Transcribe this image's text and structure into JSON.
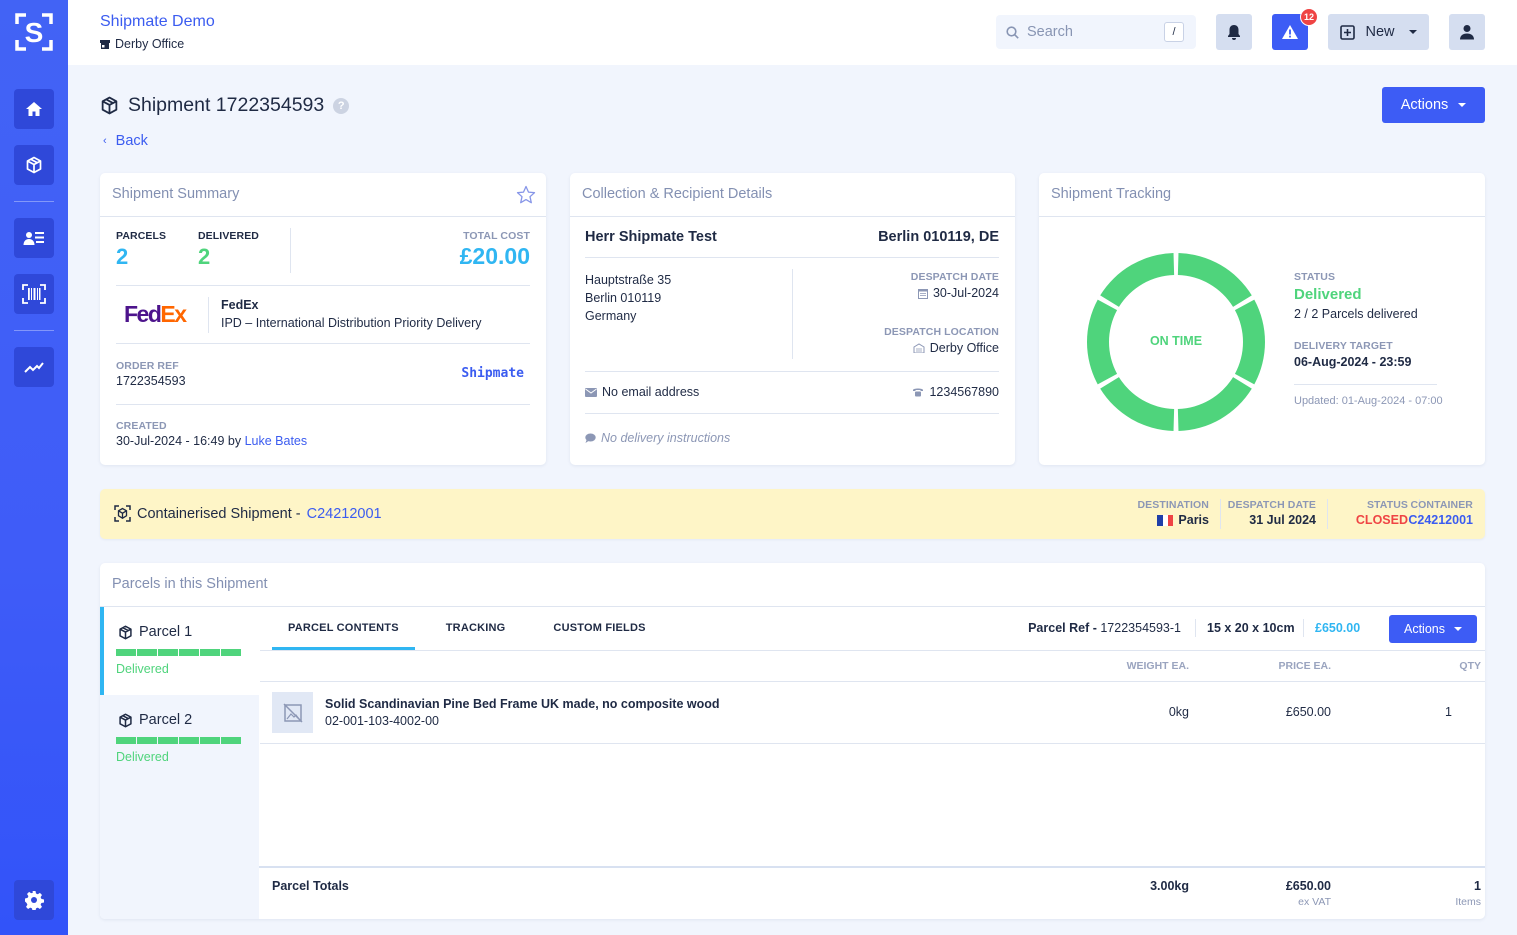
{
  "app": {
    "org_name": "Shipmate Demo",
    "office": "Derby Office"
  },
  "colors": {
    "brand": "#3d5cf5",
    "success": "#4fd47c",
    "info": "#30b6f2",
    "danger": "#ef4444",
    "container_bg": "#fef5c7"
  },
  "sidebar": {
    "items": [
      {
        "name": "home",
        "icon": "home-icon"
      },
      {
        "name": "shipments",
        "icon": "package-icon"
      },
      {
        "name": "contacts",
        "icon": "address-book-icon"
      },
      {
        "name": "scan",
        "icon": "barcode-scan-icon"
      },
      {
        "name": "reports",
        "icon": "chart-line-icon"
      },
      {
        "name": "settings",
        "icon": "gear-icon"
      }
    ]
  },
  "topbar": {
    "search_placeholder": "Search",
    "search_shortcut": "/",
    "alerts_count": "12",
    "new_label": "New"
  },
  "page": {
    "title": "Shipment 1722354593",
    "help": "?",
    "back_label": "Back",
    "actions_label": "Actions"
  },
  "summary": {
    "title": "Shipment Summary",
    "parcels_label": "PARCELS",
    "parcels_value": "2",
    "delivered_label": "DELIVERED",
    "delivered_value": "2",
    "total_cost_label": "TOTAL COST",
    "total_cost_value": "£20.00",
    "carrier_logo": "FedEx",
    "carrier_logo_a": "Fed",
    "carrier_logo_b": "Ex",
    "carrier_name": "FedEx",
    "service": "IPD – International Distribution Priority Delivery",
    "order_ref_label": "ORDER REF",
    "order_ref_value": "1722354593",
    "source_logo": "Shipmate",
    "created_label": "CREATED",
    "created_value": "30-Jul-2024 - 16:49",
    "created_by_prefix": "by",
    "created_by": "Luke Bates"
  },
  "recipient": {
    "title": "Collection & Recipient Details",
    "name": "Herr Shipmate Test",
    "city_country": "Berlin 010119, DE",
    "address_lines": [
      "Hauptstraße 35",
      "Berlin 010119",
      "Germany"
    ],
    "despatch_date_label": "DESPATCH DATE",
    "despatch_date_value": "30-Jul-2024",
    "despatch_location_label": "DESPATCH LOCATION",
    "despatch_location_value": "Derby Office",
    "email": "No email address",
    "phone": "1234567890",
    "instructions": "No delivery instructions"
  },
  "tracking": {
    "title": "Shipment Tracking",
    "ring_label": "ON TIME",
    "ring_segments_total": 6,
    "ring_segments_complete": 6,
    "status_label": "STATUS",
    "status_value": "Delivered",
    "parcels_delivered": "2 / 2 Parcels delivered",
    "target_label": "DELIVERY TARGET",
    "target_value": "06-Aug-2024 - 23:59",
    "updated": "Updated: 01-Aug-2024 - 07:00"
  },
  "container": {
    "title": "Containerised Shipment -",
    "ref": "C24212001",
    "destination_label": "DESTINATION",
    "destination_value": "Paris",
    "despatch_label": "DESPATCH DATE",
    "despatch_value": "31 Jul 2024",
    "status_label": "STATUS",
    "status_value": "CLOSED",
    "container_label": "CONTAINER",
    "container_value": "C24212001"
  },
  "parcels": {
    "title": "Parcels in this Shipment",
    "list": [
      {
        "label": "Parcel 1",
        "status": "Delivered",
        "progress_steps": 6,
        "progress_done": 6
      },
      {
        "label": "Parcel 2",
        "status": "Delivered",
        "progress_steps": 6,
        "progress_done": 6
      }
    ],
    "tabs": [
      "PARCEL CONTENTS",
      "TRACKING",
      "CUSTOM FIELDS"
    ],
    "ref_label": "Parcel Ref -",
    "ref_value": "1722354593-1",
    "dimensions": "15 x 20 x 10cm",
    "value": "£650.00",
    "actions_label": "Actions",
    "columns": [
      "WEIGHT EA.",
      "PRICE EA.",
      "QTY"
    ],
    "items": [
      {
        "name": "Solid Scandinavian Pine Bed Frame UK made, no composite wood",
        "sku": "02-001-103-4002-00",
        "weight": "0kg",
        "price": "£650.00",
        "qty": "1"
      }
    ],
    "totals": {
      "label": "Parcel Totals",
      "weight": "3.00kg",
      "price": "£650.00",
      "price_note": "ex VAT",
      "qty": "1",
      "qty_note": "Items"
    }
  }
}
